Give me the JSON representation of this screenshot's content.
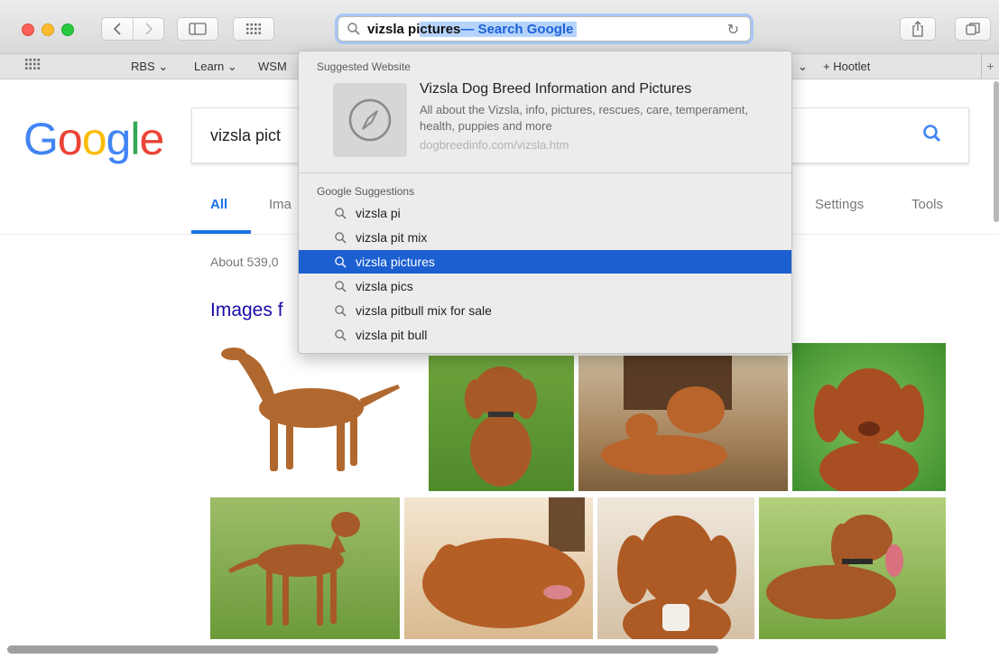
{
  "toolbar": {
    "address": {
      "typed": "vizsla pi",
      "selected": "ctures",
      "completion_hint": "— Search Google"
    }
  },
  "bookmarks": [
    "RBS ⌄",
    "Learn ⌄",
    "WSM",
    "⌄",
    "+ Hootlet"
  ],
  "google": {
    "logo_letters": [
      "G",
      "o",
      "o",
      "g",
      "l",
      "e"
    ],
    "query": "vizsla pict",
    "tabs": {
      "all": "All",
      "images": "Ima",
      "settings": "Settings",
      "tools": "Tools"
    },
    "result_stats": "About 539,0",
    "images_heading": "Images f"
  },
  "dropdown": {
    "suggested_title": "Suggested Website",
    "site": {
      "title": "Vizsla Dog Breed Information and Pictures",
      "description": "All about the Vizsla, info, pictures, rescues, care, temperament, health, puppies and more",
      "url": "dogbreedinfo.com/vizsla.htm"
    },
    "suggestions_title": "Google Suggestions",
    "suggestions": [
      "vizsla pi",
      "vizsla pit mix",
      "vizsla pictures",
      "vizsla pics",
      "vizsla pitbull mix for sale",
      "vizsla pit bull"
    ],
    "selected_index": 2
  },
  "colors": {
    "selection": "#1b5fd1",
    "google_blue": "#4285f4",
    "google_red": "#ea4335",
    "google_yellow": "#fbbc05",
    "google_green": "#34a853"
  }
}
